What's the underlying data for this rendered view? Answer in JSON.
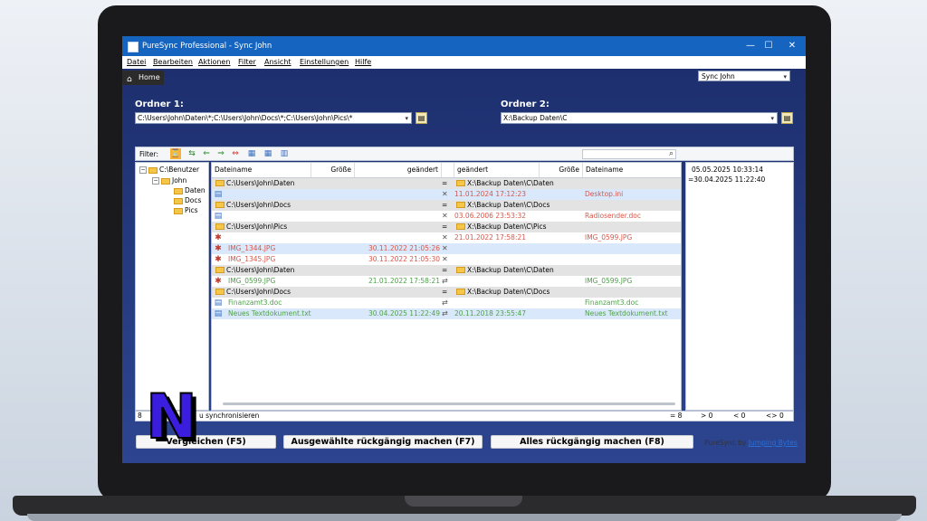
{
  "window": {
    "title": "PureSync Professional - Sync John",
    "minimize_glyph": "—",
    "maximize_glyph": "☐",
    "close_glyph": "✕"
  },
  "menu": [
    "Datei",
    "Bearbeiten",
    "Aktionen",
    "Filter",
    "Ansicht",
    "Einstellungen",
    "Hilfe"
  ],
  "home_tab": {
    "label": "Home",
    "icon": "home-icon"
  },
  "profile_select": {
    "value": "Sync John"
  },
  "folder1": {
    "label": "Ordner 1:",
    "path": "C:\\Users\\John\\Daten\\*;C:\\Users\\John\\Docs\\*;C:\\Users\\John\\Pics\\*"
  },
  "folder2": {
    "label": "Ordner 2:",
    "path": "X:\\Backup Daten\\C"
  },
  "filterbar": {
    "label": "Filter:"
  },
  "tree": {
    "root": "C:\\Benutzer",
    "user": "John",
    "children": [
      "Daten",
      "Docs",
      "Pics"
    ]
  },
  "columns": {
    "name_left": "Dateiname",
    "size_left": "Größe",
    "changed_left": "geändert",
    "changed_right": "geändert",
    "size_right": "Größe",
    "name_right": "Dateiname"
  },
  "rows": [
    {
      "type": "folder",
      "left": "C:\\Users\\John\\Daten",
      "mid": "=",
      "right": "X:\\Backup Daten\\C\\Daten"
    },
    {
      "type": "file",
      "sel": true,
      "color": "red",
      "name_l": "",
      "date_l": "",
      "mark": "✕",
      "date_r": "11.01.2024 17:12:23",
      "name_r": "Desktop.ini"
    },
    {
      "type": "folder",
      "left": "C:\\Users\\John\\Docs",
      "mid": "=",
      "right": "X:\\Backup Daten\\C\\Docs"
    },
    {
      "type": "file",
      "sel": false,
      "color": "red",
      "name_l": "",
      "date_l": "",
      "mark": "✕",
      "date_r": "03.06.2006 23:53:32",
      "name_r": "Radiosender.doc"
    },
    {
      "type": "folder",
      "left": "C:\\Users\\John\\Pics",
      "mid": "=",
      "right": "X:\\Backup Daten\\C\\Pics"
    },
    {
      "type": "file",
      "sel": false,
      "color": "red",
      "name_l": "",
      "date_l": "",
      "mark": "✕",
      "date_r": "21.01.2022 17:58:21",
      "name_r": "IMG_0599.JPG"
    },
    {
      "type": "file",
      "sel": true,
      "color": "red",
      "name_l": "IMG_1344.JPG",
      "date_l": "30.11.2022 21:05:26",
      "mark": "✕",
      "date_r": "",
      "name_r": ""
    },
    {
      "type": "file",
      "sel": false,
      "color": "red",
      "name_l": "IMG_1345.JPG",
      "date_l": "30.11.2022 21:05:30",
      "mark": "✕",
      "date_r": "",
      "name_r": ""
    },
    {
      "type": "folder",
      "left": "C:\\Users\\John\\Daten",
      "mid": "=",
      "right": "X:\\Backup Daten\\C\\Daten"
    },
    {
      "type": "file",
      "sel": false,
      "color": "green",
      "name_l": "IMG_0599.JPG",
      "date_l": "21.01.2022 17:58:21",
      "mark": "⇄",
      "date_r": "",
      "name_r": "IMG_0599.JPG"
    },
    {
      "type": "folder",
      "left": "C:\\Users\\John\\Docs",
      "mid": "=",
      "right": "X:\\Backup Daten\\C\\Docs"
    },
    {
      "type": "file",
      "sel": false,
      "color": "green",
      "name_l": "Finanzamt3.doc",
      "date_l": "",
      "mark": "⇄",
      "date_r": "",
      "name_r": "Finanzamt3.doc"
    },
    {
      "type": "file",
      "sel": true,
      "color": "green",
      "name_l": "Neues Textdokument.txt",
      "date_l": "30.04.2025 11:22:49",
      "mark": "⇄",
      "date_r": "20.11.2018 23:55:47",
      "name_r": "Neues Textdokument.txt"
    }
  ],
  "info": {
    "line1": "05.05.2025 10:33:14",
    "line2": "=30.04.2025 11:22:40"
  },
  "status": {
    "left_partial": "8",
    "left_text": "u synchronisieren",
    "eq": "= 8",
    "gt": "> 0",
    "lt": "< 0",
    "ne": "<> 0"
  },
  "buttons": {
    "compare": "Vergleichen (F5)",
    "undo_selected": "Ausgewählte rückgängig machen (F7)",
    "undo_all": "Alles rückgängig machen  (F8)"
  },
  "credit": {
    "prefix": "PureSync by",
    "link": "Jumping Bytes"
  },
  "overlay_logo": {
    "letter": "N",
    "fill": "#3b1de0",
    "shadow": "#000000"
  }
}
